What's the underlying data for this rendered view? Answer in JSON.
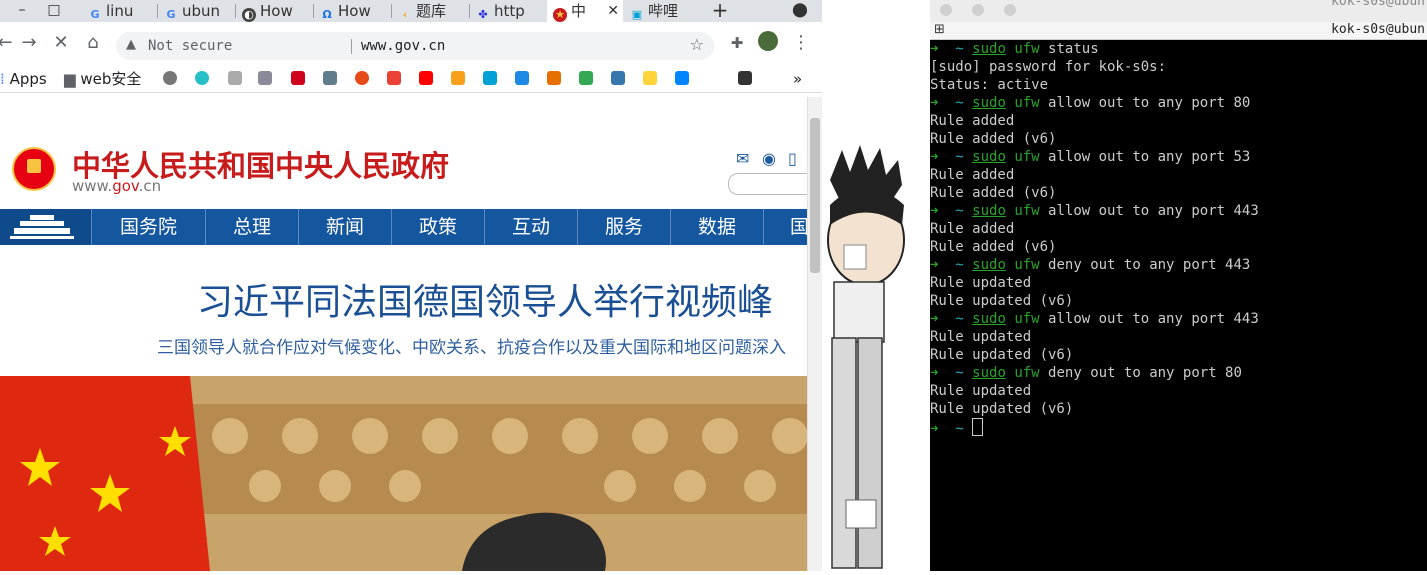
{
  "browser": {
    "window_controls": [
      "–",
      "□"
    ],
    "tabs": [
      {
        "label": "linu",
        "icon": "google-icon",
        "color": "#4285f4"
      },
      {
        "label": "ubun",
        "icon": "google-icon",
        "color": "#4285f4"
      },
      {
        "label": "How",
        "icon": "stackexchange-icon",
        "color": "#444444"
      },
      {
        "label": "How",
        "icon": "help-icon",
        "color": "#1a73e8"
      },
      {
        "label": "题库",
        "icon": "leetcode-icon",
        "color": "#f89f1b"
      },
      {
        "label": "http",
        "icon": "baidu-icon",
        "color": "#2932e1"
      },
      {
        "label": "中",
        "icon": "gov-emblem-icon",
        "color": "#c81b1b"
      },
      {
        "label": "哔哩",
        "icon": "bilibili-icon",
        "color": "#00a1d6"
      }
    ],
    "new_tab": "+",
    "address": {
      "warning": "Not secure",
      "url": "www.gov.cn"
    },
    "bookmarks": {
      "apps": "Apps",
      "folder": "web安全",
      "more": "»"
    },
    "page": {
      "site_title": "中华人民共和国中央人民政府",
      "site_domain_prefix": "www.",
      "site_domain_mid": "gov",
      "site_domain_suffix": ".cn",
      "nav": [
        "国务院",
        "总理",
        "新闻",
        "政策",
        "互动",
        "服务",
        "数据",
        "国"
      ],
      "headline": "习近平同法国德国领导人举行视频峰",
      "subline": "三国领导人就合作应对气候变化、中欧关系、抗疫合作以及重大国际和地区问题深入"
    }
  },
  "terminal": {
    "title": "kok-s0s@ubun",
    "tab_title": "kok-s0s@ubun",
    "prompt_arrow": "➜",
    "prompt_dir": "~",
    "lines": [
      {
        "type": "cmd",
        "sudo": "sudo",
        "cmd": "ufw",
        "args": " status"
      },
      {
        "type": "out",
        "text": "[sudo] password for kok-s0s:"
      },
      {
        "type": "out",
        "text": "Status: active"
      },
      {
        "type": "cmd",
        "sudo": "sudo",
        "cmd": "ufw",
        "args": " allow out to any port 80"
      },
      {
        "type": "out",
        "text": "Rule added"
      },
      {
        "type": "out",
        "text": "Rule added (v6)"
      },
      {
        "type": "cmd",
        "sudo": "sudo",
        "cmd": "ufw",
        "args": " allow out to any port 53"
      },
      {
        "type": "out",
        "text": "Rule added"
      },
      {
        "type": "out",
        "text": "Rule added (v6)"
      },
      {
        "type": "cmd",
        "sudo": "sudo",
        "cmd": "ufw",
        "args": " allow out to any port 443"
      },
      {
        "type": "out",
        "text": "Rule added"
      },
      {
        "type": "out",
        "text": "Rule added (v6)"
      },
      {
        "type": "cmd",
        "sudo": "sudo",
        "cmd": "ufw",
        "args": " deny out to any port 443"
      },
      {
        "type": "out",
        "text": "Rule updated"
      },
      {
        "type": "out",
        "text": "Rule updated (v6)"
      },
      {
        "type": "cmd",
        "sudo": "sudo",
        "cmd": "ufw",
        "args": " allow out to any port 443"
      },
      {
        "type": "out",
        "text": "Rule updated"
      },
      {
        "type": "out",
        "text": "Rule updated (v6)"
      },
      {
        "type": "cmd",
        "sudo": "sudo",
        "cmd": "ufw",
        "args": " deny out to any port 80"
      },
      {
        "type": "out",
        "text": "Rule updated"
      },
      {
        "type": "out",
        "text": "Rule updated (v6)"
      }
    ]
  }
}
